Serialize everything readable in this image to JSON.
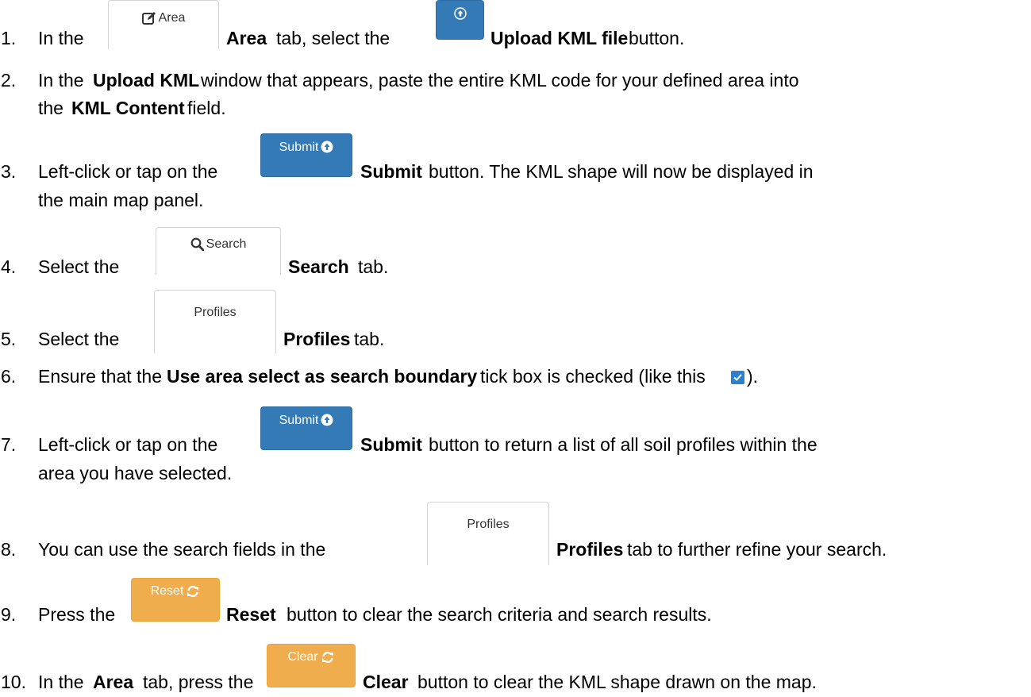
{
  "steps": [
    {
      "num": "1.",
      "a": "In the",
      "b": "Area",
      "c": "tab, select the",
      "d": "Upload KML file",
      "e": "button."
    },
    {
      "num": "2.",
      "a": "In the",
      "b": "Upload KML",
      "c": "window that appears, paste the entire KML code for your defined area into",
      "d": "the",
      "e": "KML Content",
      "f": "field."
    },
    {
      "num": "3.",
      "a": "Left-click or tap on the",
      "b": "Submit",
      "c": "button. The KML shape will now be displayed in",
      "d": "the main map panel."
    },
    {
      "num": "4.",
      "a": "Select the",
      "b": "Search",
      "c": "tab."
    },
    {
      "num": "5.",
      "a": "Select the",
      "b": "Profiles",
      "c": "tab."
    },
    {
      "num": "6.",
      "a": "Ensure that the",
      "b": "Use area select as search boundary",
      "c": "tick box is checked (like this",
      "d": ")."
    },
    {
      "num": "7.",
      "a": "Left-click or tap on the",
      "b": "Submit",
      "c": "button to return a list of all soil profiles within the",
      "d": "area you have selected."
    },
    {
      "num": "8.",
      "a": "You can use the search fields in the",
      "b": "Profiles",
      "c": "tab to further refine your search."
    },
    {
      "num": "9.",
      "a": "Press the",
      "b": "Reset",
      "c": "button to clear the search criteria and search results."
    },
    {
      "num": "10.",
      "a": "In the",
      "b": "Area",
      "c": "tab, press the",
      "d": "Clear",
      "e": "button to clear the KML shape drawn on the map."
    }
  ],
  "buttons": {
    "area_tab": "Area",
    "search_tab": "Search",
    "profiles_tab": "Profiles",
    "submit": "Submit",
    "reset": "Reset",
    "clear": "Clear"
  },
  "colors": {
    "primary": "#337ab7",
    "warning": "#f0ad4e",
    "checkbox": "#2d7fd3"
  },
  "icons": [
    "edit-icon",
    "upload-icon",
    "search-icon",
    "refresh-icon",
    "checkbox-checked-icon"
  ]
}
